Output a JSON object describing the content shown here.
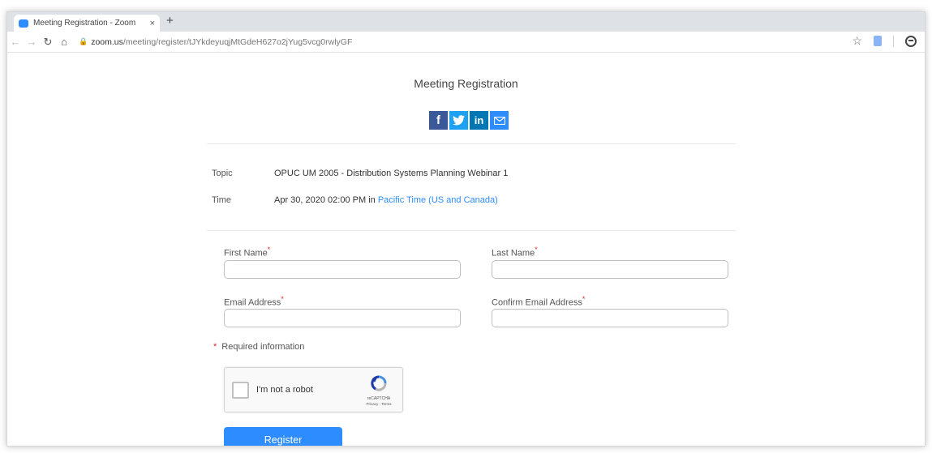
{
  "browser": {
    "tab_title": "Meeting Registration - Zoom",
    "tab_close": "×",
    "new_tab": "+",
    "url_domain": "zoom.us",
    "url_path": "/meeting/register/tJYkdeyuqjMtGdeH627o2jYug5vcg0rwlyGF"
  },
  "page": {
    "title": "Meeting Registration",
    "social": {
      "facebook": "f",
      "linkedin": "in"
    },
    "topic_label": "Topic",
    "topic_value": "OPUC UM 2005 - Distribution Systems Planning Webinar 1",
    "time_label": "Time",
    "time_value": "Apr 30, 2020 02:00 PM in ",
    "time_zone": "Pacific Time (US and Canada)"
  },
  "form": {
    "first_name_label": "First Name",
    "last_name_label": "Last Name",
    "email_label": "Email Address",
    "confirm_email_label": "Confirm Email Address",
    "required_marker": "*",
    "required_note": "Required information",
    "captcha_label": "I'm not a robot",
    "captcha_brand": "reCAPTCHA",
    "captcha_terms": "Privacy - Terms",
    "register_label": "Register"
  },
  "colors": {
    "accent": "#2d8cff",
    "required": "#e02828"
  }
}
